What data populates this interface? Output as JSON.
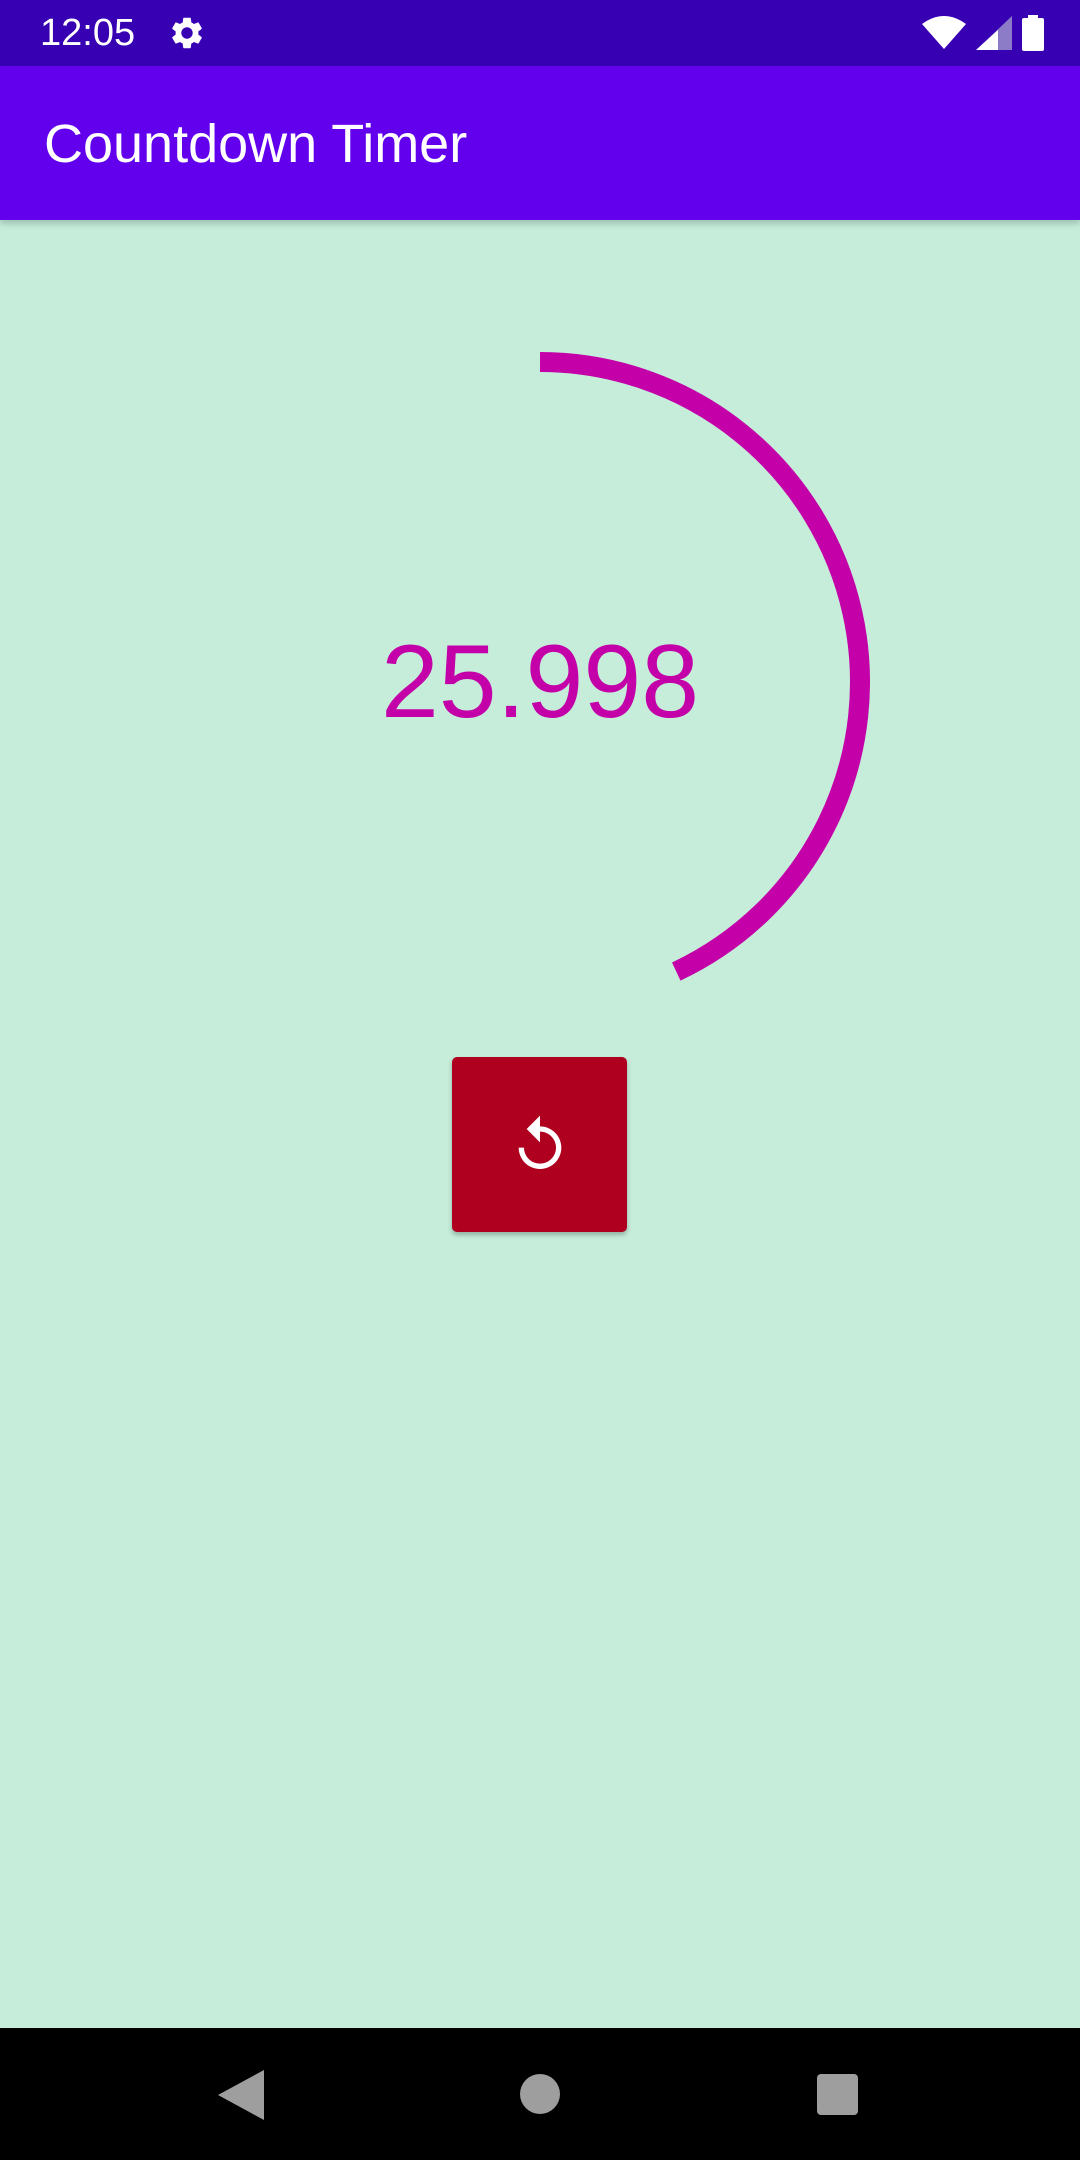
{
  "status_bar": {
    "time": "12:05",
    "icons": [
      "gear-icon",
      "wifi-icon",
      "signal-icon",
      "battery-icon"
    ],
    "background": "#3700B3"
  },
  "app_bar": {
    "title": "Countdown Timer",
    "background": "#6200EE"
  },
  "timer": {
    "value": "25.998",
    "progress": 0.43,
    "ring_color": "#C400A8"
  },
  "reset_button": {
    "icon": "replay-icon",
    "color": "#B00020"
  },
  "nav_bar": {
    "icons": [
      "back-icon",
      "home-icon",
      "recents-icon"
    ]
  },
  "colors": {
    "background": "#C5EDDA"
  }
}
